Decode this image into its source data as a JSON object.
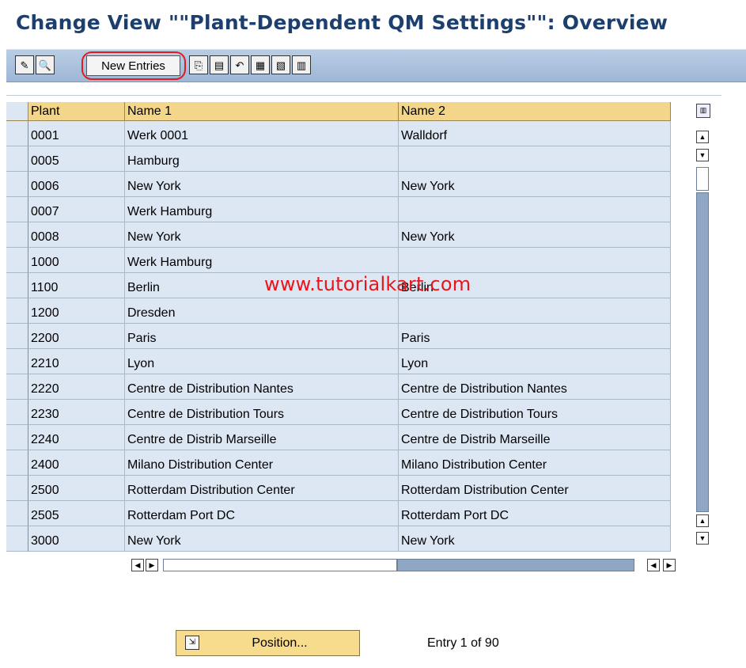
{
  "title": "Change View \"\"Plant-Dependent QM Settings\"\": Overview",
  "toolbar": {
    "new_entries_label": "New Entries",
    "icons": [
      "display-change-icon",
      "select-detail-icon",
      "copy-as-icon",
      "delete-icon",
      "undo-change-icon",
      "select-all-icon",
      "select-block-icon",
      "deselect-all-icon"
    ]
  },
  "table": {
    "headers": [
      "Plant",
      "Name 1",
      "Name 2"
    ],
    "rows": [
      {
        "plant": "0001",
        "name1": "Werk 0001",
        "name2": "Walldorf"
      },
      {
        "plant": "0005",
        "name1": "Hamburg",
        "name2": ""
      },
      {
        "plant": "0006",
        "name1": "New York",
        "name2": "New York"
      },
      {
        "plant": "0007",
        "name1": "Werk Hamburg",
        "name2": ""
      },
      {
        "plant": "0008",
        "name1": "New York",
        "name2": "New York"
      },
      {
        "plant": "1000",
        "name1": "Werk Hamburg",
        "name2": ""
      },
      {
        "plant": "1100",
        "name1": "Berlin",
        "name2": "Berlin"
      },
      {
        "plant": "1200",
        "name1": "Dresden",
        "name2": ""
      },
      {
        "plant": "2200",
        "name1": "Paris",
        "name2": "Paris"
      },
      {
        "plant": "2210",
        "name1": "Lyon",
        "name2": "Lyon"
      },
      {
        "plant": "2220",
        "name1": "Centre de Distribution Nantes",
        "name2": "Centre de Distribution Nantes"
      },
      {
        "plant": "2230",
        "name1": "Centre de Distribution Tours",
        "name2": "Centre de Distribution Tours"
      },
      {
        "plant": "2240",
        "name1": "Centre de Distrib  Marseille",
        "name2": "Centre de Distrib  Marseille"
      },
      {
        "plant": "2400",
        "name1": "Milano Distribution Center",
        "name2": "Milano Distribution Center"
      },
      {
        "plant": "2500",
        "name1": "Rotterdam Distribution Center",
        "name2": "Rotterdam Distribution Center"
      },
      {
        "plant": "2505",
        "name1": "Rotterdam Port DC",
        "name2": "Rotterdam Port DC"
      },
      {
        "plant": "3000",
        "name1": "New York",
        "name2": "New York"
      }
    ]
  },
  "watermark": "www.tutorialkart.com",
  "footer": {
    "position_label": "Position...",
    "entry_text": "Entry 1 of 90"
  },
  "colors": {
    "title": "#1d3f6e",
    "toolbar": "#b9cde5",
    "header_cell": "#f4d68a",
    "row_cell": "#dde6f3",
    "highlight": "#e21b1b",
    "watermark": "#e8161a"
  }
}
